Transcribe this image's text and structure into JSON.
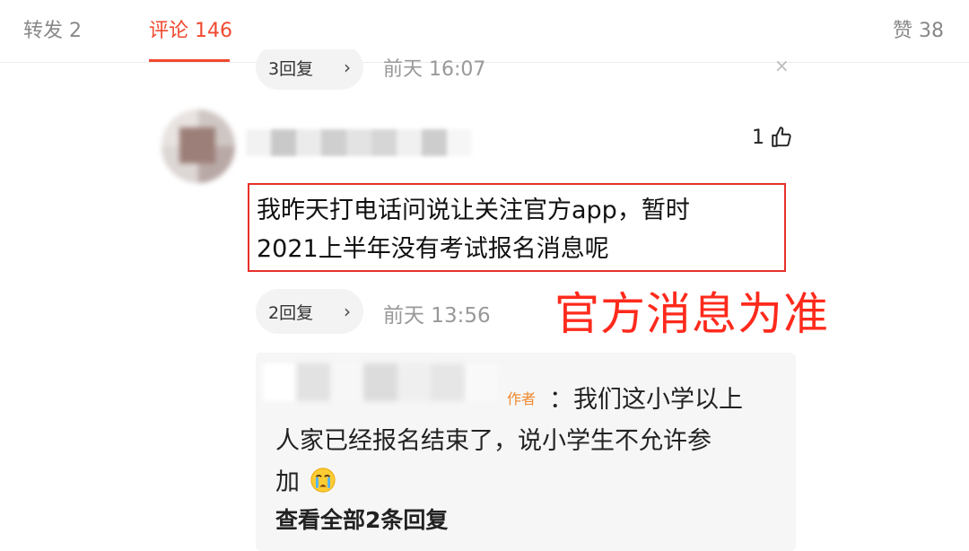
{
  "tabs": {
    "repost": "转发 2",
    "comment": "评论 146",
    "like": "赞 38"
  },
  "previous_reply": {
    "reply_count": "3回复",
    "chevron": "›",
    "time": "前天 16:07",
    "close": "×"
  },
  "comment": {
    "like_count": "1",
    "text_line1": "我昨天打电话问说让关注官方app，暂时",
    "text_line2": "2021上半年没有考试报名消息呢",
    "reply_count": "2回复",
    "chevron": "›",
    "time": "前天 13:56"
  },
  "annotation": "官方消息为准",
  "reply": {
    "author_tag": "作者",
    "text_line1": "：我们这小学以上",
    "text_line2": "人家已经报名结束了，说小学生不允许参",
    "text_line3": "加",
    "emoji": "crying-face-icon",
    "view_all": "查看全部2条回复"
  },
  "colors": {
    "accent": "#f0492f",
    "highlight_border": "#e8302a",
    "annotation": "#ff2a1c",
    "author_tag": "#f0892f"
  }
}
